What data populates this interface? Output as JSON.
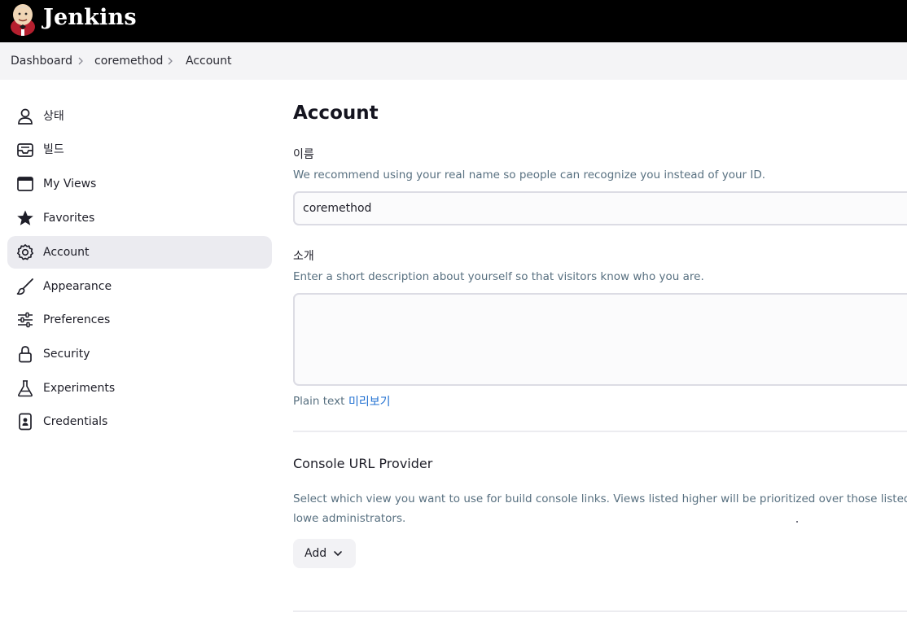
{
  "header": {
    "brand": "Jenkins",
    "logo_icon": "jenkins-butler-icon"
  },
  "breadcrumb": [
    {
      "label": "Dashboard"
    },
    {
      "label": "coremethod"
    },
    {
      "label": "Account"
    }
  ],
  "sidebar": {
    "items": [
      {
        "label": "상태",
        "icon": "person-icon",
        "active": false
      },
      {
        "label": "빌드",
        "icon": "inbox-icon",
        "active": false
      },
      {
        "label": "My Views",
        "icon": "window-icon",
        "active": false
      },
      {
        "label": "Favorites",
        "icon": "star-icon",
        "active": false
      },
      {
        "label": "Account",
        "icon": "gear-icon",
        "active": true
      },
      {
        "label": "Appearance",
        "icon": "brush-icon",
        "active": false
      },
      {
        "label": "Preferences",
        "icon": "sliders-icon",
        "active": false
      },
      {
        "label": "Security",
        "icon": "lock-icon",
        "active": false
      },
      {
        "label": "Experiments",
        "icon": "flask-icon",
        "active": false
      },
      {
        "label": "Credentials",
        "icon": "id-card-icon",
        "active": false
      }
    ]
  },
  "main": {
    "title": "Account",
    "name_field": {
      "label": "이름",
      "help": "We recommend using your real name so people can recognize you instead of your ID.",
      "value": "coremethod"
    },
    "description_field": {
      "label": "소개",
      "help": "Enter a short description about yourself so that visitors know who you are.",
      "value": "",
      "format_label": "Plain text",
      "preview_link": "미리보기"
    },
    "console_url": {
      "title": "Console URL Provider",
      "description": "Select which view you want to use for build console links. Views listed higher will be prioritized over those listed lowe administrators.",
      "add_label": "Add"
    }
  },
  "colors": {
    "header_bg": "#000000",
    "breadcrumb_bg": "#f4f4f6",
    "active_item_bg": "#ebebf0",
    "help_text": "#587080",
    "link": "#1f6fd1"
  }
}
